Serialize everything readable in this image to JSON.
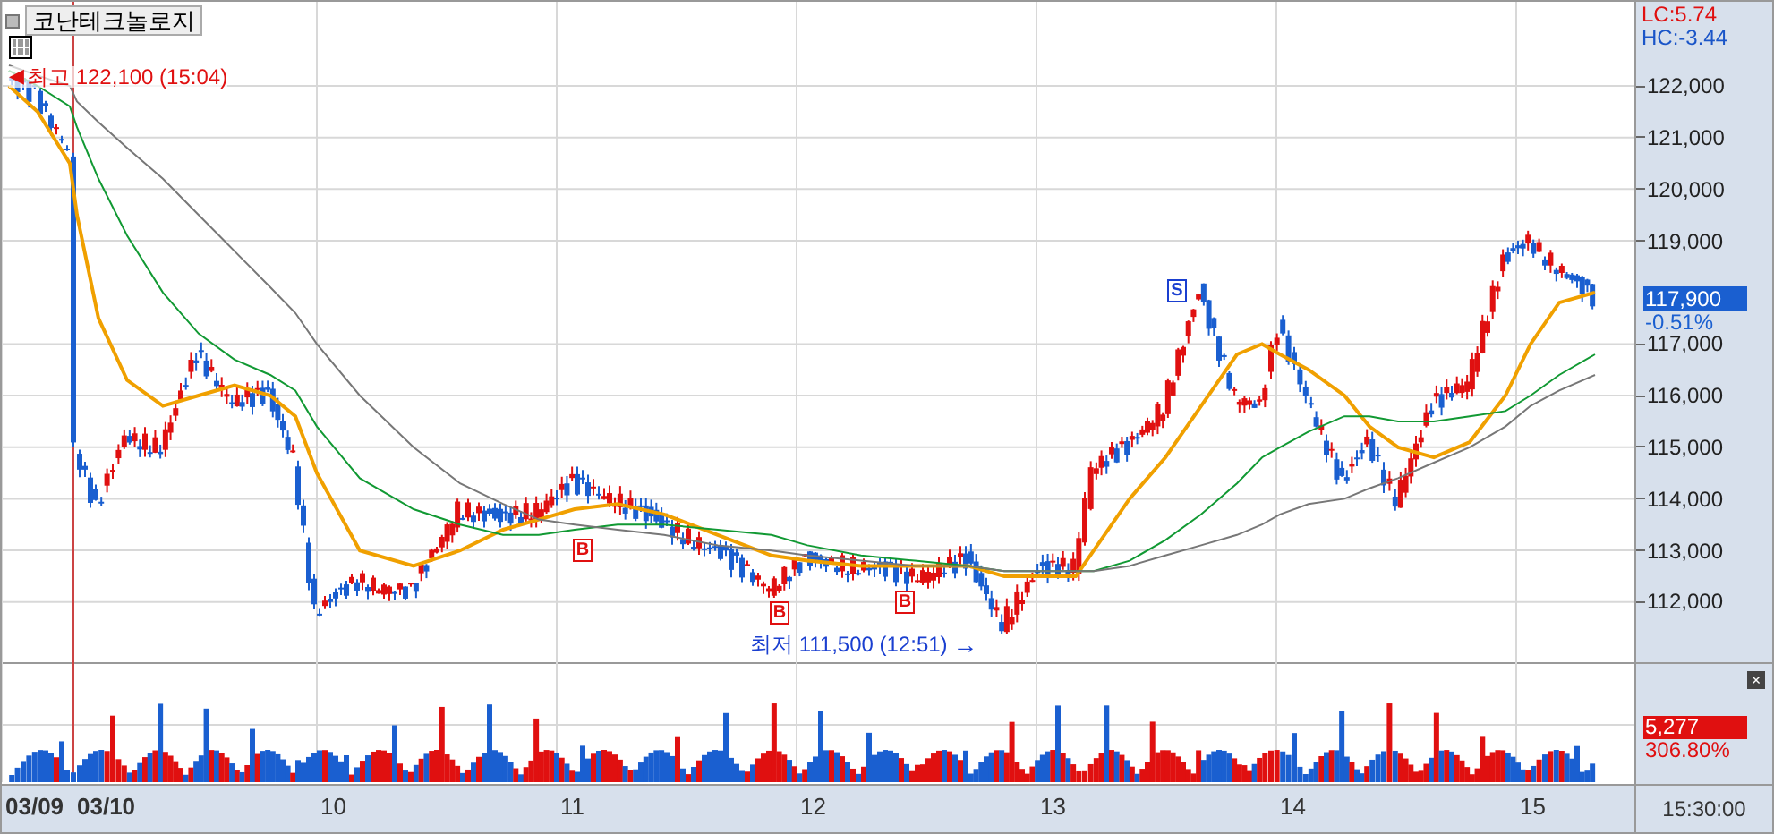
{
  "title_button": "코난테크놀로지",
  "indicators": [
    {
      "text": "LC:5.74",
      "color": "#e01010"
    },
    {
      "text": "HC:-3.44",
      "color": "#1a55c8"
    }
  ],
  "price_axis": {
    "labels": [
      "122,000",
      "121,000",
      "120,000",
      "119,000",
      "117,000",
      "116,000",
      "115,000",
      "114,000",
      "113,000",
      "112,000"
    ]
  },
  "annotations": [
    {
      "kind": "high",
      "arrow": "◀",
      "text": "최고 122,100 (15:04)"
    },
    {
      "kind": "low",
      "arrow": "→",
      "text": "최저 111,500 (12:51)"
    }
  ],
  "signals": [
    {
      "kind": "buy",
      "label": "B"
    },
    {
      "kind": "buy",
      "label": "B"
    },
    {
      "kind": "buy",
      "label": "B"
    },
    {
      "kind": "sell",
      "label": "S"
    }
  ],
  "current_price": {
    "value": "117,900",
    "change": "-0.51%"
  },
  "volume": {
    "value": "5,277",
    "ratio": "306.80%",
    "close": "×"
  },
  "date_axis": {
    "labels": [
      "03/09",
      "03/10",
      "10",
      "11",
      "12",
      "13",
      "14",
      "15"
    ]
  },
  "time": "15:30:00"
}
